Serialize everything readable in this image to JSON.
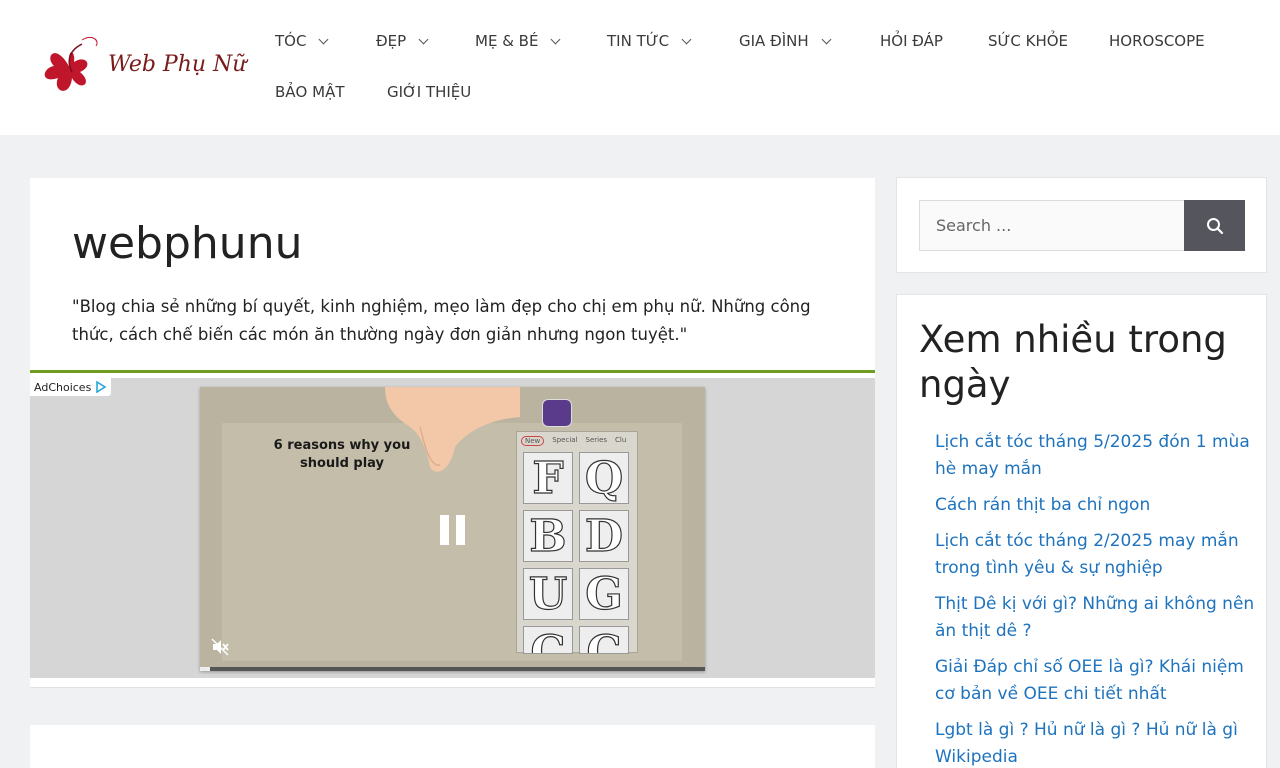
{
  "header": {
    "logo_text": "Web Phụ Nữ",
    "nav": [
      {
        "label": "TÓC",
        "has_dropdown": true
      },
      {
        "label": "ĐẸP",
        "has_dropdown": true
      },
      {
        "label": "MẸ & BÉ",
        "has_dropdown": true
      },
      {
        "label": "TIN TỨC",
        "has_dropdown": true
      },
      {
        "label": "GIA ĐÌNH",
        "has_dropdown": true
      },
      {
        "label": "HỎI ĐÁP",
        "has_dropdown": false
      },
      {
        "label": "SỨC KHỎE",
        "has_dropdown": false
      },
      {
        "label": "HOROSCOPE",
        "has_dropdown": false
      },
      {
        "label": "BẢO MẬT",
        "has_dropdown": false
      },
      {
        "label": "GIỚI THIỆU",
        "has_dropdown": false
      }
    ]
  },
  "main": {
    "site_title": "webphunu",
    "site_description": "\"Blog chia sẻ những bí quyết, kinh nghiệm, mẹo làm đẹp cho chị em phụ nữ. Những công thức, cách chế biến các món ăn thường ngày đơn giản nhưng ngon tuyệt.\"",
    "ad": {
      "adchoices_label": "AdChoices",
      "video_caption": "6 reasons why you should play",
      "tablet_tabs": [
        "New",
        "Special",
        "Series",
        "Clu"
      ],
      "tile_letters": [
        "F",
        "Q",
        "B",
        "D",
        "U",
        "G",
        "C",
        "C"
      ],
      "progress": 0.02
    }
  },
  "sidebar": {
    "search": {
      "placeholder": "Search ..."
    },
    "popular": {
      "title": "Xem nhiều trong ngày",
      "items": [
        "Lịch cắt tóc tháng 5/2025 đón 1 mùa hè may mắn",
        "Cách rán thịt ba chỉ ngon",
        "Lịch cắt tóc tháng 2/2025 may mắn trong tình yêu & sự nghiệp",
        "Thịt Dê kị với gì? Những ai không nên ăn thịt dê ?",
        "Giải Đáp chỉ số OEE là gì? Khái niệm cơ bản về OEE chi tiết nhất",
        "Lgbt là gì ? Hủ nữ là gì ? Hủ nữ là gì Wikipedia"
      ]
    }
  },
  "colors": {
    "accent_green": "#6e9d1f",
    "link_blue": "#1e73be",
    "search_button": "#55555e"
  }
}
